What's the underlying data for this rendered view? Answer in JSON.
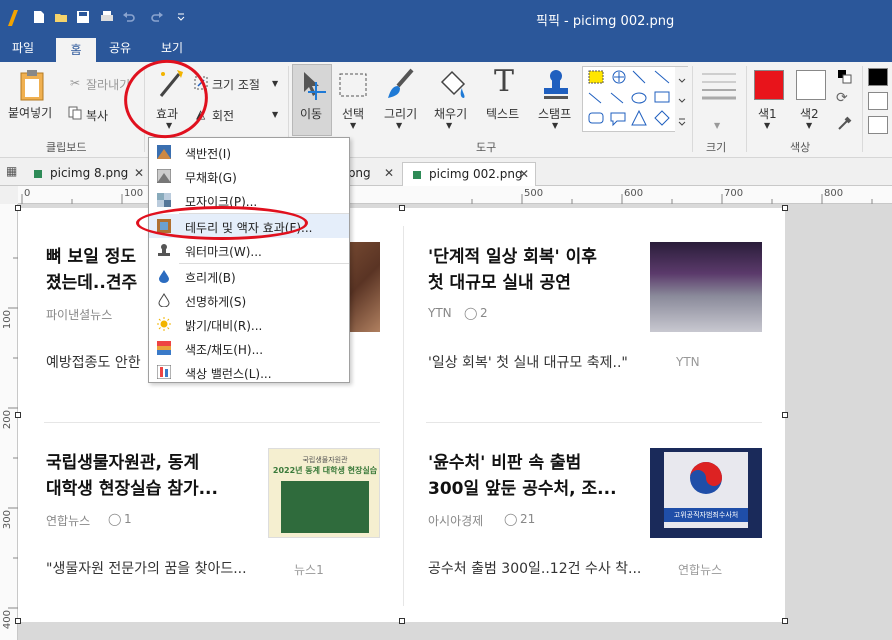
{
  "window": {
    "title": "픽픽 - picimg 002.png"
  },
  "menu_tabs": [
    "파일",
    "홈",
    "공유",
    "보기"
  ],
  "active_menu_tab": "홈",
  "ribbon": {
    "clipboard": {
      "paste": "붙여넣기",
      "cut": "잘라내기",
      "copy": "복사",
      "group": "클립보드"
    },
    "effects": {
      "effect": "효과",
      "resize": "크기 조절",
      "rotate": "회전"
    },
    "tools": {
      "move": "이동",
      "select": "선택",
      "draw": "그리기",
      "fill": "채우기",
      "text": "텍스트",
      "stamp": "스탬프",
      "group": "도구"
    },
    "size": {
      "group": "크기"
    },
    "color": {
      "color1": "색1",
      "color2": "색2",
      "group": "색상",
      "color1_value": "#e8141b",
      "color2_value": "#ffffff"
    }
  },
  "doc_tabs": [
    {
      "name": "picimg 8.png",
      "active": false
    },
    {
      "name": ".png",
      "active": false
    },
    {
      "name": "picimg 002.png",
      "active": true
    }
  ],
  "ruler": {
    "h_marks": [
      "0",
      "100",
      "500",
      "600",
      "700",
      "800"
    ],
    "v_marks": [
      "100",
      "200",
      "300",
      "400"
    ]
  },
  "effects_menu": [
    {
      "label": "색반전(I)",
      "icon": "invert-icon"
    },
    {
      "label": "무채화(G)",
      "icon": "grayscale-icon"
    },
    {
      "label": "모자이크(P)...",
      "icon": "mosaic-icon"
    },
    {
      "label": "테두리 및 액자 효과(F)...",
      "icon": "frame-icon"
    },
    {
      "label": "워터마크(W)...",
      "icon": "watermark-icon"
    },
    {
      "label": "흐리게(B)",
      "icon": "blur-icon"
    },
    {
      "label": "선명하게(S)",
      "icon": "sharpen-icon"
    },
    {
      "label": "밝기/대비(R)...",
      "icon": "brightness-icon"
    },
    {
      "label": "색조/채도(H)...",
      "icon": "hue-icon"
    },
    {
      "label": "색상 밸런스(L)...",
      "icon": "balance-icon"
    }
  ],
  "articles": [
    {
      "title_l1": "뼈 보일 정도",
      "title_l2": "졌는데..견주",
      "source": "파이낸셜뉴스",
      "desc": "예방접종도 안한"
    },
    {
      "title_l1": "'단계적 일상 회복' 이후",
      "title_l2": "첫 대규모 실내 공연",
      "source": "YTN",
      "comments": "2",
      "desc": "'일상 회복' 첫 실내 대규모 축제..\"",
      "desc_src": "YTN"
    },
    {
      "title_l1": "국립생물자원관, 동계",
      "title_l2": "대학생 현장실습 참가...",
      "source": "연합뉴스",
      "comments": "1",
      "desc": "\"생물자원 전문가의 꿈을 찾아드...",
      "desc_src": "뉴스1",
      "thumb_line1": "국립생물자원관",
      "thumb_line2": "2022년 동계 대학생 현장실습"
    },
    {
      "title_l1": "'윤수처' 비판 속 출범",
      "title_l2": "300일 앞둔 공수처, 조...",
      "source": "아시아경제",
      "comments": "21",
      "desc": "공수처 출범 300일..12건 수사 착...",
      "desc_src": "연합뉴스",
      "thumb_text": "고위공직자범죄수사처"
    }
  ]
}
